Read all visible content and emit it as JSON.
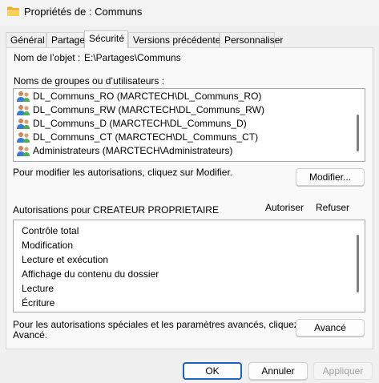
{
  "window": {
    "title": "Propriétés de : Communs"
  },
  "tabs": [
    {
      "label": "Général"
    },
    {
      "label": "Partage"
    },
    {
      "label": "Sécurité"
    },
    {
      "label": "Versions précédentes"
    },
    {
      "label": "Personnaliser"
    }
  ],
  "security": {
    "object_label": "Nom de l’objet :",
    "object_value": "E:\\Partages\\Communs",
    "groups_label": "Noms de groupes ou d’utilisateurs :",
    "groups": [
      {
        "name": "DL_Communs_RO (MARCTECH\\DL_Communs_RO)"
      },
      {
        "name": "DL_Communs_RW (MARCTECH\\DL_Communs_RW)"
      },
      {
        "name": "DL_Communs_D (MARCTECH\\DL_Communs_D)"
      },
      {
        "name": "DL_Communs_CT (MARCTECH\\DL_Communs_CT)"
      },
      {
        "name": "Administrateurs (MARCTECH\\Administrateurs)"
      }
    ],
    "modify_hint": "Pour modifier les autorisations, cliquez sur Modifier.",
    "modify_button": "Modifier...",
    "permissions_label": "Autorisations pour CREATEUR PROPRIETAIRE",
    "allow_header": "Autoriser",
    "deny_header": "Refuser",
    "permissions": [
      {
        "name": "Contrôle total"
      },
      {
        "name": "Modification"
      },
      {
        "name": "Lecture et exécution"
      },
      {
        "name": "Affichage du contenu du dossier"
      },
      {
        "name": "Lecture"
      },
      {
        "name": "Écriture"
      }
    ],
    "advanced_hint_line1": "Pour les autorisations spéciales et les paramètres avancés, cliquez sur",
    "advanced_hint_line2": "Avancé.",
    "advanced_button": "Avancé"
  },
  "footer": {
    "ok_label": "OK",
    "cancel_label": "Annuler",
    "apply_label": "Appliquer"
  },
  "colors": {
    "default_button_border": "#1f63b8",
    "folder_yellow": "#f4c44a"
  }
}
